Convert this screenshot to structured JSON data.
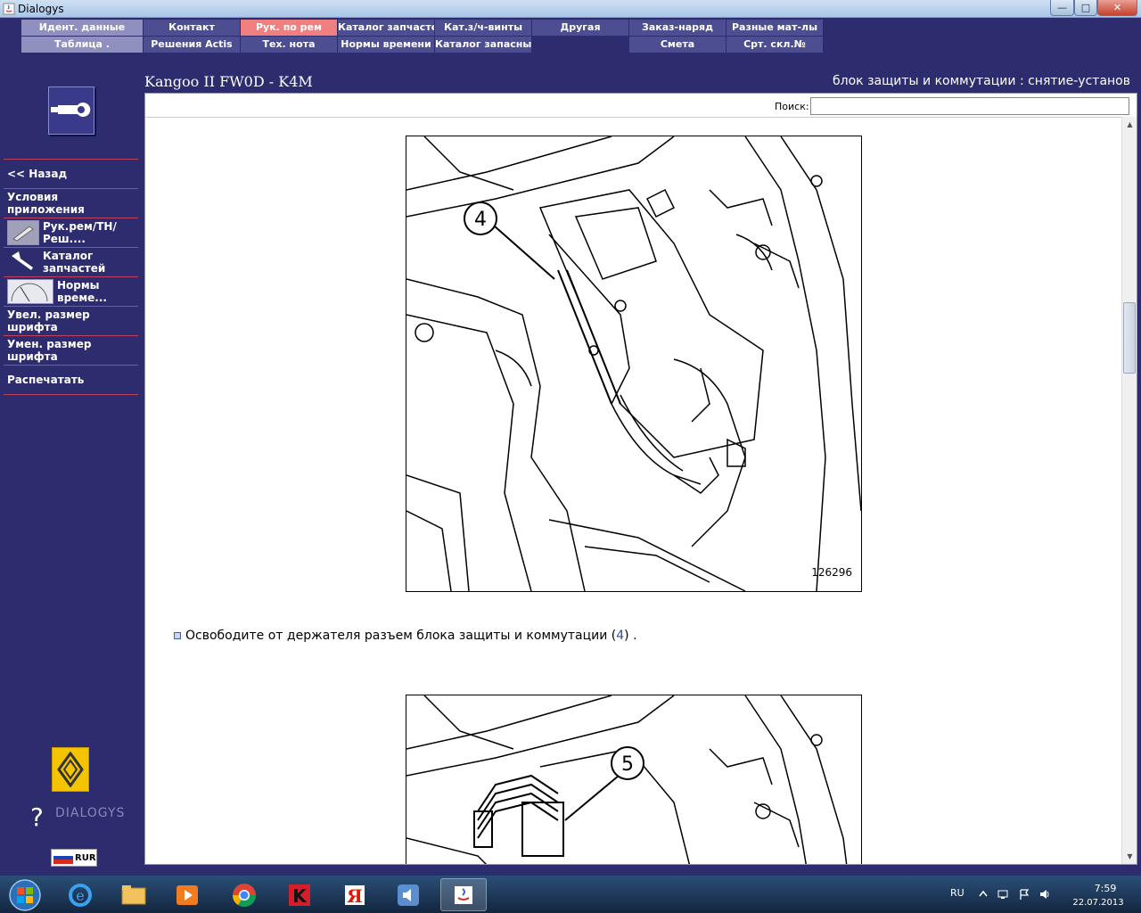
{
  "window": {
    "title": "Dialogys",
    "min": "—",
    "max": "□",
    "close": "✕"
  },
  "menu": {
    "row1": [
      "Идент. данные",
      "Контакт",
      "Рук. по рем",
      "Каталог запчастей",
      "Кат.з/ч-винты",
      "Другая",
      "Заказ-наряд",
      "Разные мат-лы"
    ],
    "row2": [
      "Таблица .",
      "Решения Actis",
      "Тех. нота",
      "Нормы времени",
      "Каталог запасны...",
      "Смета",
      "Срт. скл.№"
    ]
  },
  "header": {
    "vehicle": "Kangoo II FW0D - K4M",
    "procedure": "блок защиты и коммутации : снятие-установ"
  },
  "sidebar": {
    "items": [
      {
        "label": "<< Назад"
      },
      {
        "label": "Условия приложения"
      },
      {
        "label": "Рук.рем/ТН/Реш...."
      },
      {
        "label": "Каталог запчастей"
      },
      {
        "label": "Нормы време..."
      },
      {
        "label": "Увел. размер шрифта"
      },
      {
        "label": "Умен. размер шрифта"
      },
      {
        "label": "Распечатать"
      }
    ],
    "brand": "DIALOGYS",
    "currency": "RUR"
  },
  "content": {
    "search_label": "Поиск:",
    "search_value": "",
    "figure1": {
      "id": "126296",
      "callout": "4"
    },
    "instruction": {
      "text": "Освободите от держателя разъем блока защиты и коммутации (",
      "ref": "4",
      "end": ") ."
    },
    "figure2": {
      "callout": "5"
    }
  },
  "taskbar": {
    "lang": "RU",
    "time": "7:59",
    "date": "22.07.2013"
  },
  "colors": {
    "background": "#2c2c6e",
    "menu": "#4d4d91",
    "menu_light": "#8f8fc0",
    "menu_active": "#f08080",
    "separator": "#c04060"
  }
}
